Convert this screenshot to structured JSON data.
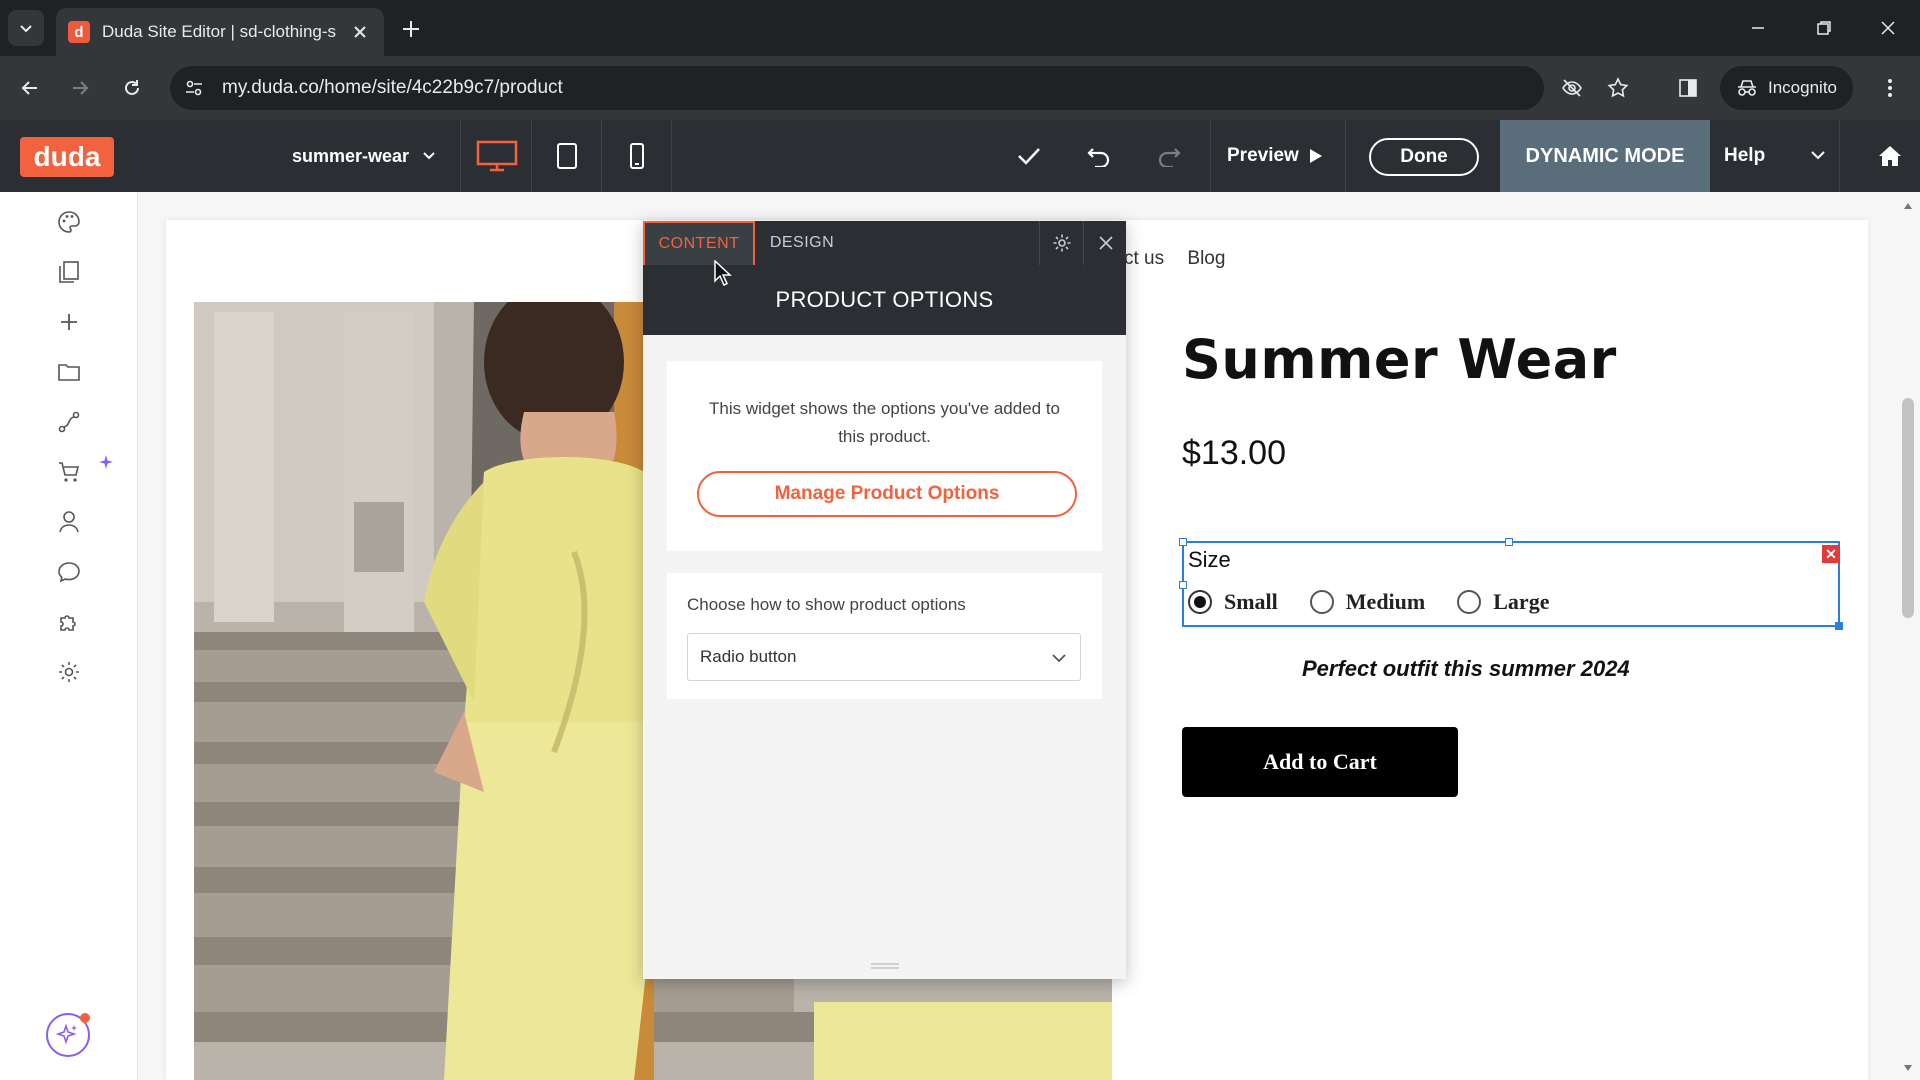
{
  "browser": {
    "tab_title": "Duda Site Editor | sd-clothing-s",
    "favicon_letter": "d",
    "url": "my.duda.co/home/site/4c22b9c7/product",
    "incognito_label": "Incognito"
  },
  "editor": {
    "logo": "duda",
    "page_name": "summer-wear",
    "preview_label": "Preview",
    "done_label": "Done",
    "mode_label": "DYNAMIC MODE",
    "help_label": "Help"
  },
  "site": {
    "nav_links": [
      "ct us",
      "Blog"
    ],
    "product_title": "Summer Wear",
    "price": "$13.00",
    "size_label": "Size",
    "size_options": [
      "Small",
      "Medium",
      "Large"
    ],
    "selected_size": "Small",
    "tagline": "Perfect outfit this summer 2024",
    "cart_button": "Add to Cart"
  },
  "panel": {
    "tab_content": "CONTENT",
    "tab_design": "DESIGN",
    "title": "PRODUCT OPTIONS",
    "description": "This widget shows the options you've added to this product.",
    "manage_button": "Manage Product Options",
    "display_label": "Choose how to show product options",
    "display_value": "Radio button"
  },
  "colors": {
    "brand": "#f2623f",
    "selection": "#2b7de0",
    "dynamic_mode_bg": "#5a6d7a"
  }
}
